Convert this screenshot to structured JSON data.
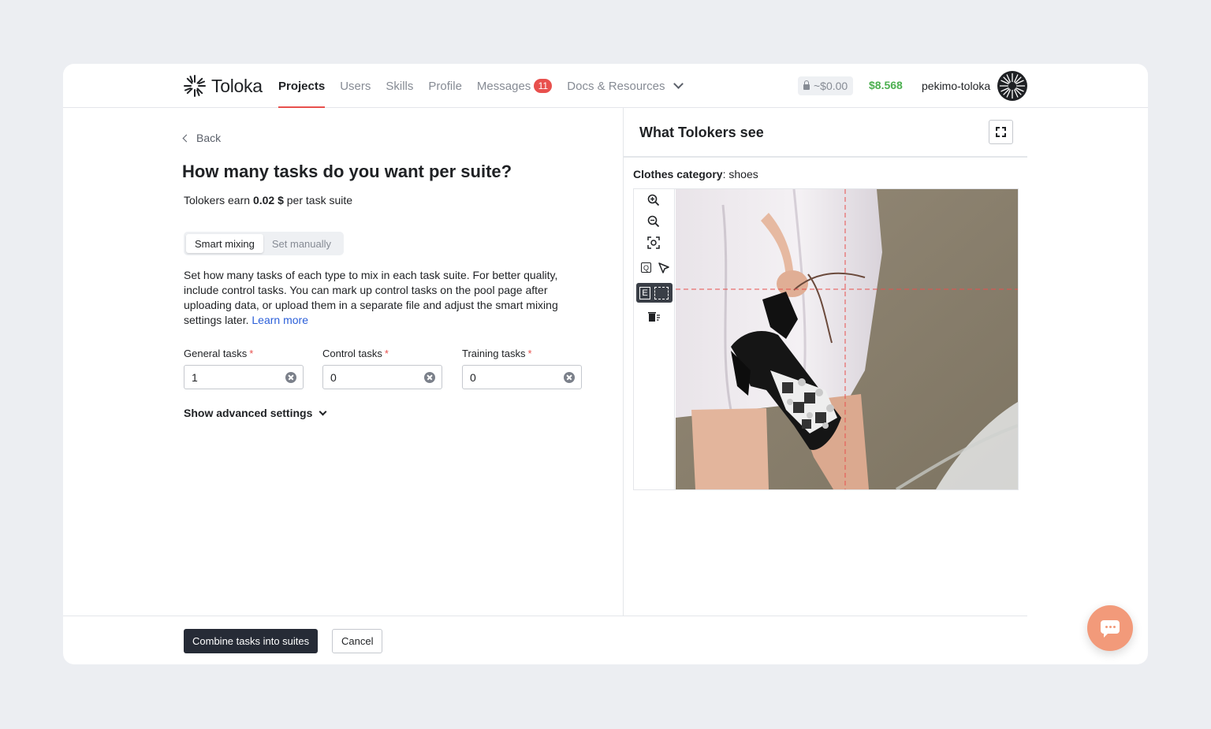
{
  "header": {
    "logo": "Toloka",
    "nav": [
      {
        "label": "Projects",
        "active": true
      },
      {
        "label": "Users"
      },
      {
        "label": "Skills"
      },
      {
        "label": "Profile"
      },
      {
        "label": "Messages",
        "badge": "11"
      },
      {
        "label": "Docs & Resources"
      }
    ],
    "locked_balance": "~$0.00",
    "balance": "$8.568",
    "username": "pekimo-toloka"
  },
  "main": {
    "back_label": "Back",
    "title": "How many tasks do you want per suite?",
    "earn_prefix": "Tolokers earn ",
    "earn_amount": "0.02 $",
    "earn_suffix": " per task suite",
    "mix_tabs": [
      {
        "label": "Smart mixing",
        "selected": true
      },
      {
        "label": "Set manually",
        "selected": false
      }
    ],
    "description": "Set how many tasks of each type to mix in each task suite. For better quality, include control tasks. You can mark up control tasks on the pool page after uploading data, or upload them in a separate file and adjust the smart mixing settings later.",
    "learn_more": "Learn more",
    "fields": [
      {
        "label": "General tasks",
        "value": "1",
        "required": "*"
      },
      {
        "label": "Control tasks",
        "value": "0",
        "required": "*"
      },
      {
        "label": "Training tasks",
        "value": "0",
        "required": "*"
      }
    ],
    "advanced_label": "Show advanced settings"
  },
  "preview": {
    "title": "What Tolokers see",
    "category_label": "Clothes category",
    "category_value": ": shoes",
    "tools": [
      "zoom-in-icon",
      "zoom-out-icon",
      "fit-icon",
      "polygon-icon",
      "pointer-icon",
      "bounding-box-icon",
      "delete-icon"
    ],
    "tool_q_letter": "Q",
    "tool_e_letter": "E"
  },
  "footer": {
    "primary_label": "Combine tasks into suites",
    "cancel_label": "Cancel"
  },
  "colors": {
    "accent": "#e8504d",
    "balance": "#4caf50",
    "link": "#2b5fd9",
    "primary_button": "#262b36",
    "chat": "#f29a7a"
  }
}
